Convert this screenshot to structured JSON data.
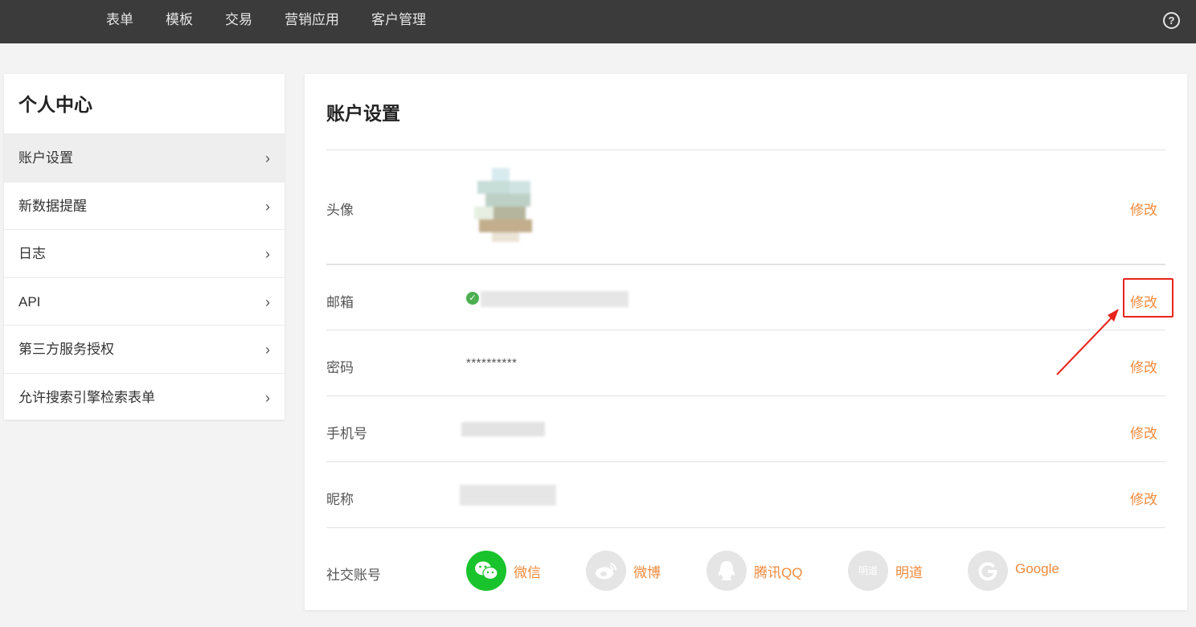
{
  "topnav": {
    "items": [
      "表单",
      "模板",
      "交易",
      "营销应用",
      "客户管理"
    ],
    "help_glyph": "?"
  },
  "sidebar": {
    "title": "个人中心",
    "chevron": "›",
    "items": [
      {
        "label": "账户设置",
        "active": true
      },
      {
        "label": "新数据提醒"
      },
      {
        "label": "日志"
      },
      {
        "label": "API"
      },
      {
        "label": "第三方服务授权"
      },
      {
        "label": "允许搜索引擎检索表单"
      }
    ]
  },
  "main": {
    "title": "账户设置",
    "edit_label": "修改",
    "rows": {
      "avatar": {
        "label": "头像"
      },
      "email": {
        "label": "邮箱",
        "verified_glyph": "✓"
      },
      "password": {
        "label": "密码",
        "value": "**********"
      },
      "phone": {
        "label": "手机号"
      },
      "nickname": {
        "label": "昵称"
      },
      "social": {
        "label": "社交账号"
      }
    },
    "social_accounts": [
      {
        "name": "微信",
        "icon": "wechat-icon",
        "bound": true,
        "color": "#19c32c"
      },
      {
        "name": "微博",
        "icon": "weibo-icon",
        "bound": false
      },
      {
        "name": "腾讯QQ",
        "icon": "qq-icon",
        "bound": false
      },
      {
        "name": "明道",
        "icon": "mingdao-icon",
        "bound": false,
        "icon_text": "明道"
      },
      {
        "name": "Google",
        "icon": "google-icon",
        "bound": false
      }
    ]
  },
  "colors": {
    "topbar": "#3b3b3b",
    "accent": "#f08a3c",
    "highlight": "#e8241c",
    "wechat": "#19c32c"
  }
}
